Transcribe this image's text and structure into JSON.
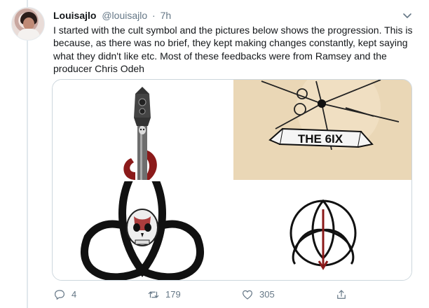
{
  "tweet": {
    "author_name": "Louisajlo",
    "author_handle": "@louisajlo",
    "separator": "·",
    "timestamp": "7h",
    "text": "I started with the cult symbol and the pictures below shows the progression. This is because, as there was no brief, they kept making changes constantly, kept saying what they didn't like etc. Most of these feedbacks were from Ramsey and the producer Chris Odeh"
  },
  "media": {
    "image_2_banner_text": "THE 6IX"
  },
  "actions": {
    "reply_count": "4",
    "retweet_count": "179",
    "like_count": "305"
  },
  "icons": {
    "caret": "chevron-down-icon",
    "reply": "reply-icon",
    "retweet": "retweet-icon",
    "like": "heart-icon",
    "share": "share-icon"
  },
  "colors": {
    "text_primary": "#14171a",
    "text_secondary": "#657786",
    "border": "#ccd6dd",
    "logo_red": "#8b1a1a"
  }
}
